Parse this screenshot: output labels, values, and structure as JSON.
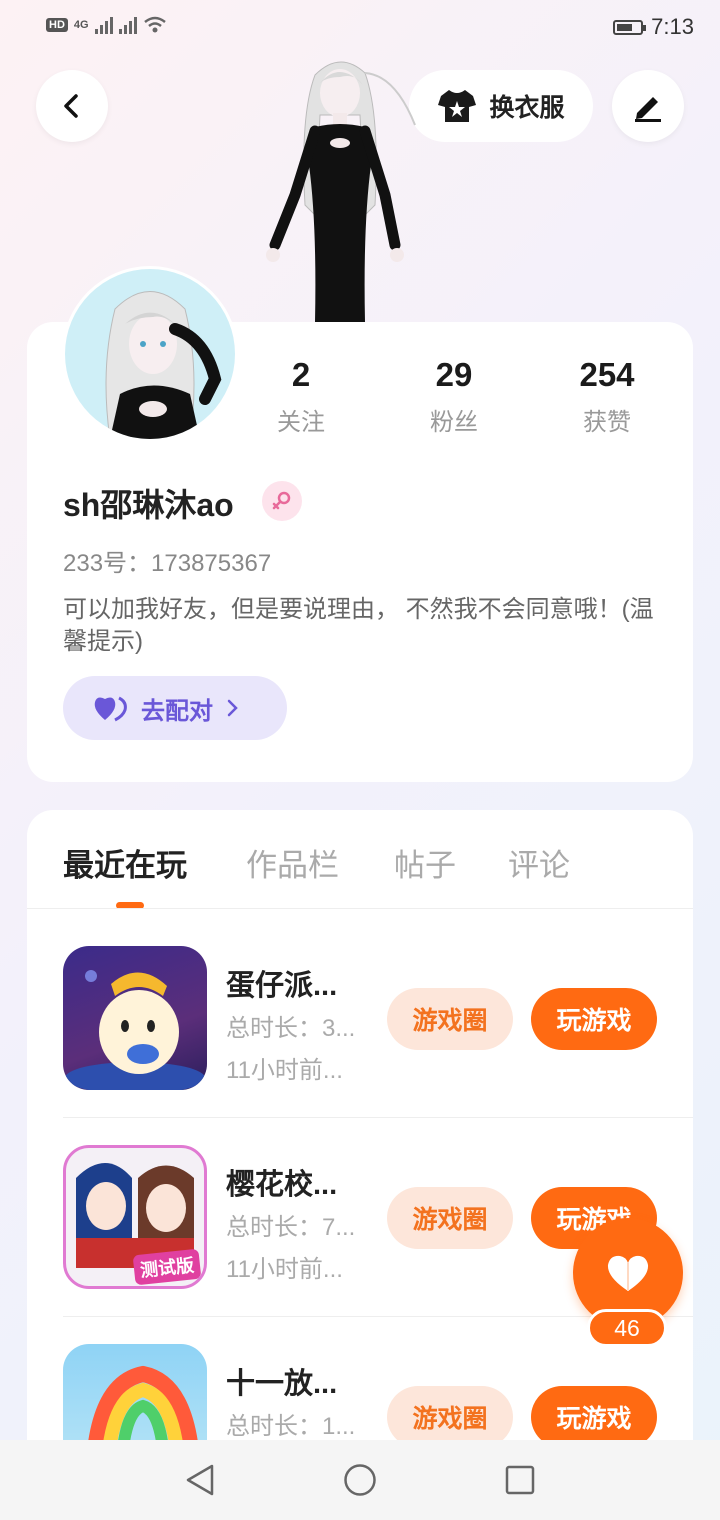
{
  "status_bar": {
    "hd": "HD",
    "network": "4G",
    "time": "7:13",
    "battery_level": 0.7
  },
  "header": {
    "outfit_label": "换衣服"
  },
  "profile": {
    "stats": [
      {
        "value": "2",
        "label": "关注"
      },
      {
        "value": "29",
        "label": "粉丝"
      },
      {
        "value": "254",
        "label": "获赞"
      }
    ],
    "username": "sh邵琳沐ao",
    "user_id": "233号：173875367",
    "bio": "可以加我好友，但是要说理由， 不然我不会同意哦！(温馨提示)",
    "pair_label": "去配对"
  },
  "tabs": [
    "最近在玩",
    "作品栏",
    "帖子",
    "评论"
  ],
  "games": [
    {
      "name": "蛋仔派...",
      "duration": "总时长：3...",
      "last_played": "11小时前..."
    },
    {
      "name": "樱花校...",
      "duration": "总时长：7...",
      "last_played": "11小时前...",
      "icon_badge": "测试版"
    },
    {
      "name": "十一放...",
      "duration": "总时长：1...",
      "last_played": ""
    }
  ],
  "game_buttons": {
    "circle": "游戏圈",
    "play": "玩游戏"
  },
  "like_count": "46",
  "colors": {
    "accent": "#ff6a12",
    "pair_purple": "#6a57d8"
  }
}
